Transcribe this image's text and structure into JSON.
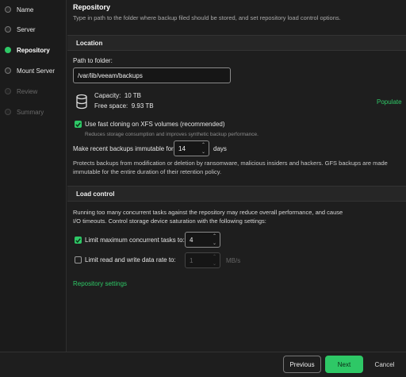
{
  "sidebar": {
    "steps": [
      {
        "label": "Name",
        "state": "done"
      },
      {
        "label": "Server",
        "state": "done"
      },
      {
        "label": "Repository",
        "state": "active"
      },
      {
        "label": "Mount Server",
        "state": "done"
      },
      {
        "label": "Review",
        "state": "todo"
      },
      {
        "label": "Summary",
        "state": "todo"
      }
    ]
  },
  "page": {
    "title": "Repository",
    "subtitle": "Type in path to the folder where backup filed should be stored, and set repository load control options."
  },
  "location": {
    "header": "Location",
    "path_label": "Path to folder:",
    "path_value": "/var/lib/veeam/backups",
    "capacity_label": "Capacity:",
    "capacity_value": "10 TB",
    "free_label": "Free space:",
    "free_value": "9.93 TB",
    "populate_label": "Populate",
    "fast_clone_label": "Use fast cloning on XFS volumes (recommended)",
    "fast_clone_checked": true,
    "fast_clone_hint": "Reduces storage consumption and improves synthetic backup performance.",
    "immutable_label": "Make recent backups immutable for:",
    "immutable_value": "14",
    "immutable_unit": "days",
    "immutable_desc_1": "Protects backups from modification or deletion by ransomware, malicious insiders and hackers. GFS backups are made",
    "immutable_desc_2": "immutable for the entire duration of their retention policy."
  },
  "load_control": {
    "header": "Load control",
    "desc_1": "Running too many concurrent tasks against the repository may reduce overall performance, and cause",
    "desc_2": "I/O timeouts. Control storage device saturation with the following settings:",
    "limit_tasks_label": "Limit maximum concurrent tasks to:",
    "limit_tasks_checked": true,
    "limit_tasks_value": "4",
    "limit_rate_label": "Limit read and write data rate to:",
    "limit_rate_checked": false,
    "limit_rate_value": "1",
    "limit_rate_unit": "MB/s",
    "settings_link": "Repository settings"
  },
  "footer": {
    "previous_label": "Previous",
    "next_label": "Next",
    "cancel_label": "Cancel"
  },
  "colors": {
    "accent": "#2ec866",
    "background": "#1e1e1e"
  }
}
